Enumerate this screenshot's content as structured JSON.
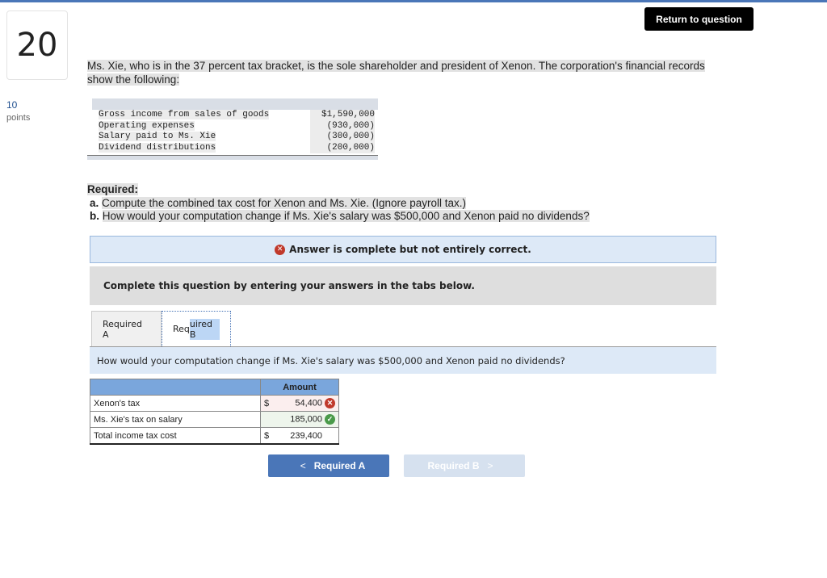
{
  "question": {
    "number": "20",
    "points_value": "10",
    "points_label": "points"
  },
  "header": {
    "return_button": "Return to question"
  },
  "intro": {
    "line1": "Ms. Xie, who is in the 37 percent tax bracket, is the sole shareholder and president of Xenon. The corporation's financial records",
    "line2": "show the following:"
  },
  "financials": [
    {
      "label": "Gross income from sales of goods",
      "value": "$1,590,000"
    },
    {
      "label": "Operating expenses",
      "value": "(930,000)"
    },
    {
      "label": "Salary paid to Ms. Xie",
      "value": "(300,000)"
    },
    {
      "label": "Dividend distributions",
      "value": "(200,000)"
    }
  ],
  "required": {
    "heading": "Required:",
    "items": [
      {
        "letter": "a.",
        "text": "Compute the combined tax cost for Xenon and Ms. Xie. (Ignore payroll tax.)"
      },
      {
        "letter": "b.",
        "text": "How would your computation change if Ms. Xie's salary was $500,000 and Xenon paid no dividends?"
      }
    ]
  },
  "alert": {
    "icon": "x-circle-icon",
    "text": "Answer is complete but not entirely correct."
  },
  "instruction": "Complete this question by entering your answers in the tabs below.",
  "tabs": [
    {
      "label": "Required A",
      "active": false
    },
    {
      "label_pre": "Req",
      "label_hl": "uired B",
      "active": true
    }
  ],
  "tab_question": "How would your computation change if Ms. Xie's salary was $500,000 and Xenon paid no dividends?",
  "answer_table": {
    "header": "Amount",
    "rows": [
      {
        "label": "Xenon's tax",
        "currency": "$",
        "value": "54,400",
        "status": "incorrect"
      },
      {
        "label": "Ms. Xie's tax on salary",
        "currency": "",
        "value": "185,000",
        "status": "correct"
      },
      {
        "label": "Total income tax cost",
        "currency": "$",
        "value": "239,400",
        "status": ""
      }
    ]
  },
  "nav": {
    "prev": "Required A",
    "next": "Required B",
    "prev_chevron": "<",
    "next_chevron": ">"
  },
  "colors": {
    "accent": "#4a76b8",
    "error": "#c0392b",
    "success": "#4a9a4a"
  }
}
